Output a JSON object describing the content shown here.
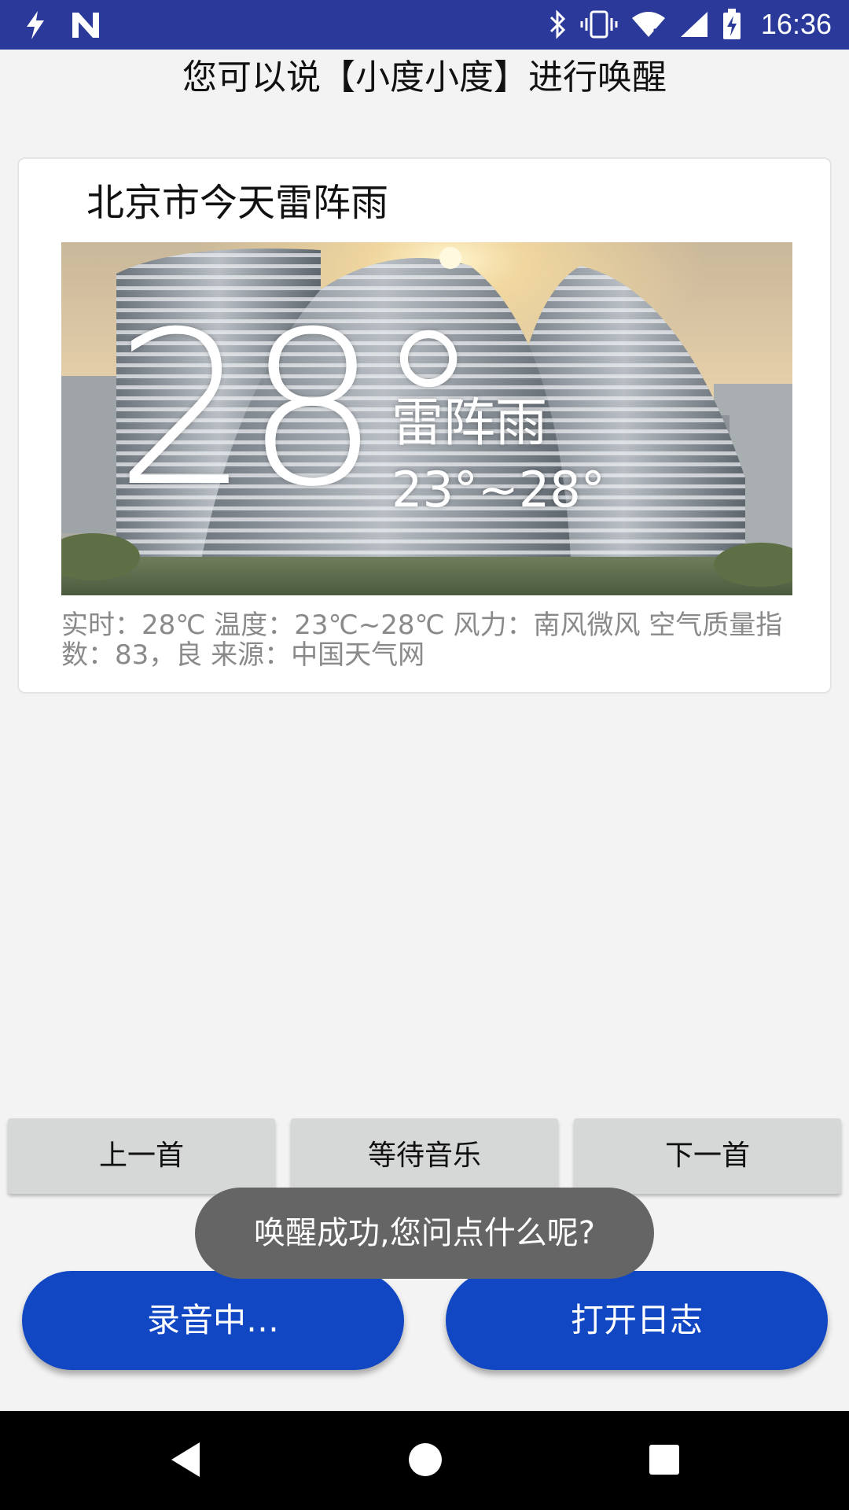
{
  "status_bar": {
    "time": "16:36",
    "icons_left": [
      "flash-icon",
      "n-logo-icon"
    ],
    "icons_right": [
      "bluetooth-icon",
      "vibrate-icon",
      "wifi-icon",
      "signal-icon",
      "battery-charging-icon"
    ]
  },
  "hint": "您可以说【小度小度】进行唤醒",
  "weather_card": {
    "title": "北京市今天雷阵雨",
    "image": {
      "temperature": "28°",
      "condition": "雷阵雨",
      "range": "23°~28°"
    },
    "detail": "实时：28℃ 温度：23℃~28℃ 风力：南风微风 空气质量指数：83，良 来源：中国天气网"
  },
  "music_controls": {
    "prev": "上一首",
    "wait": "等待音乐",
    "next": "下一首"
  },
  "toast": "唤醒成功,您问点什么呢?",
  "actions": {
    "record": "录音中…",
    "open_log": "打开日志"
  },
  "colors": {
    "status_bar": "#2b3a9a",
    "primary": "#1247c4",
    "toast_bg": "#656565"
  }
}
